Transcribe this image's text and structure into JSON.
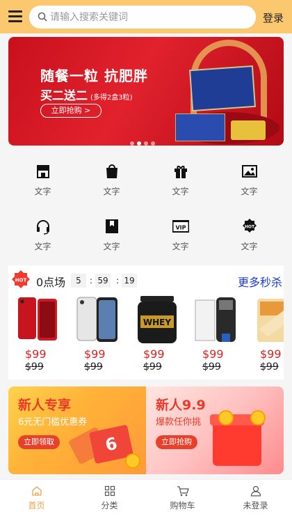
{
  "header": {
    "search_placeholder": "请输入搜索关键词",
    "login_label": "登录"
  },
  "banner": {
    "headline": "随餐一粒 抗肥胖",
    "offer": "买二送二",
    "offer_note": "(多得2盒3粒)",
    "cta": "立即抢购 >",
    "slides": 4,
    "active_slide": 2
  },
  "categories": [
    {
      "icon": "store-icon",
      "label": "文字"
    },
    {
      "icon": "shopping-bag-icon",
      "label": "文字"
    },
    {
      "icon": "gift-icon",
      "label": "文字"
    },
    {
      "icon": "image-icon",
      "label": "文字"
    },
    {
      "icon": "headset-icon",
      "label": "文字"
    },
    {
      "icon": "bookmark-icon",
      "label": "文字"
    },
    {
      "icon": "vip-icon",
      "label": "文字"
    },
    {
      "icon": "hot-badge-icon",
      "label": "文字"
    }
  ],
  "flash_sale": {
    "badge": "HOT",
    "session": "0点场",
    "hours": "5",
    "minutes": "59",
    "seconds": "19",
    "more_label": "更多秒杀",
    "products": [
      {
        "name": "iphone-xr-red",
        "price": "$99",
        "old_price": "$99"
      },
      {
        "name": "iphone-x-silver",
        "price": "$99",
        "old_price": "$99"
      },
      {
        "name": "whey-protein",
        "price": "$99",
        "old_price": "$99"
      },
      {
        "name": "braun-shaver",
        "price": "$99",
        "old_price": "$99"
      },
      {
        "name": "bread-snack",
        "price": "$99",
        "old_price": "$99"
      }
    ]
  },
  "promos": {
    "left": {
      "title": "新人专享",
      "subtitle": "6元无门槛优惠券",
      "button": "立即领取",
      "coupon_value": "6"
    },
    "right": {
      "title": "新人9.9",
      "subtitle": "爆款任你挑",
      "button": "立即抢购"
    }
  },
  "tabbar": [
    {
      "label": "首页",
      "active": true
    },
    {
      "label": "分类",
      "active": false
    },
    {
      "label": "购物车",
      "active": false
    },
    {
      "label": "未登录",
      "active": false
    }
  ],
  "colors": {
    "header_bg": "#fcc86f",
    "accent_price": "#e02020",
    "link_blue": "#1a3bd6",
    "tab_active": "#e8a34a"
  }
}
